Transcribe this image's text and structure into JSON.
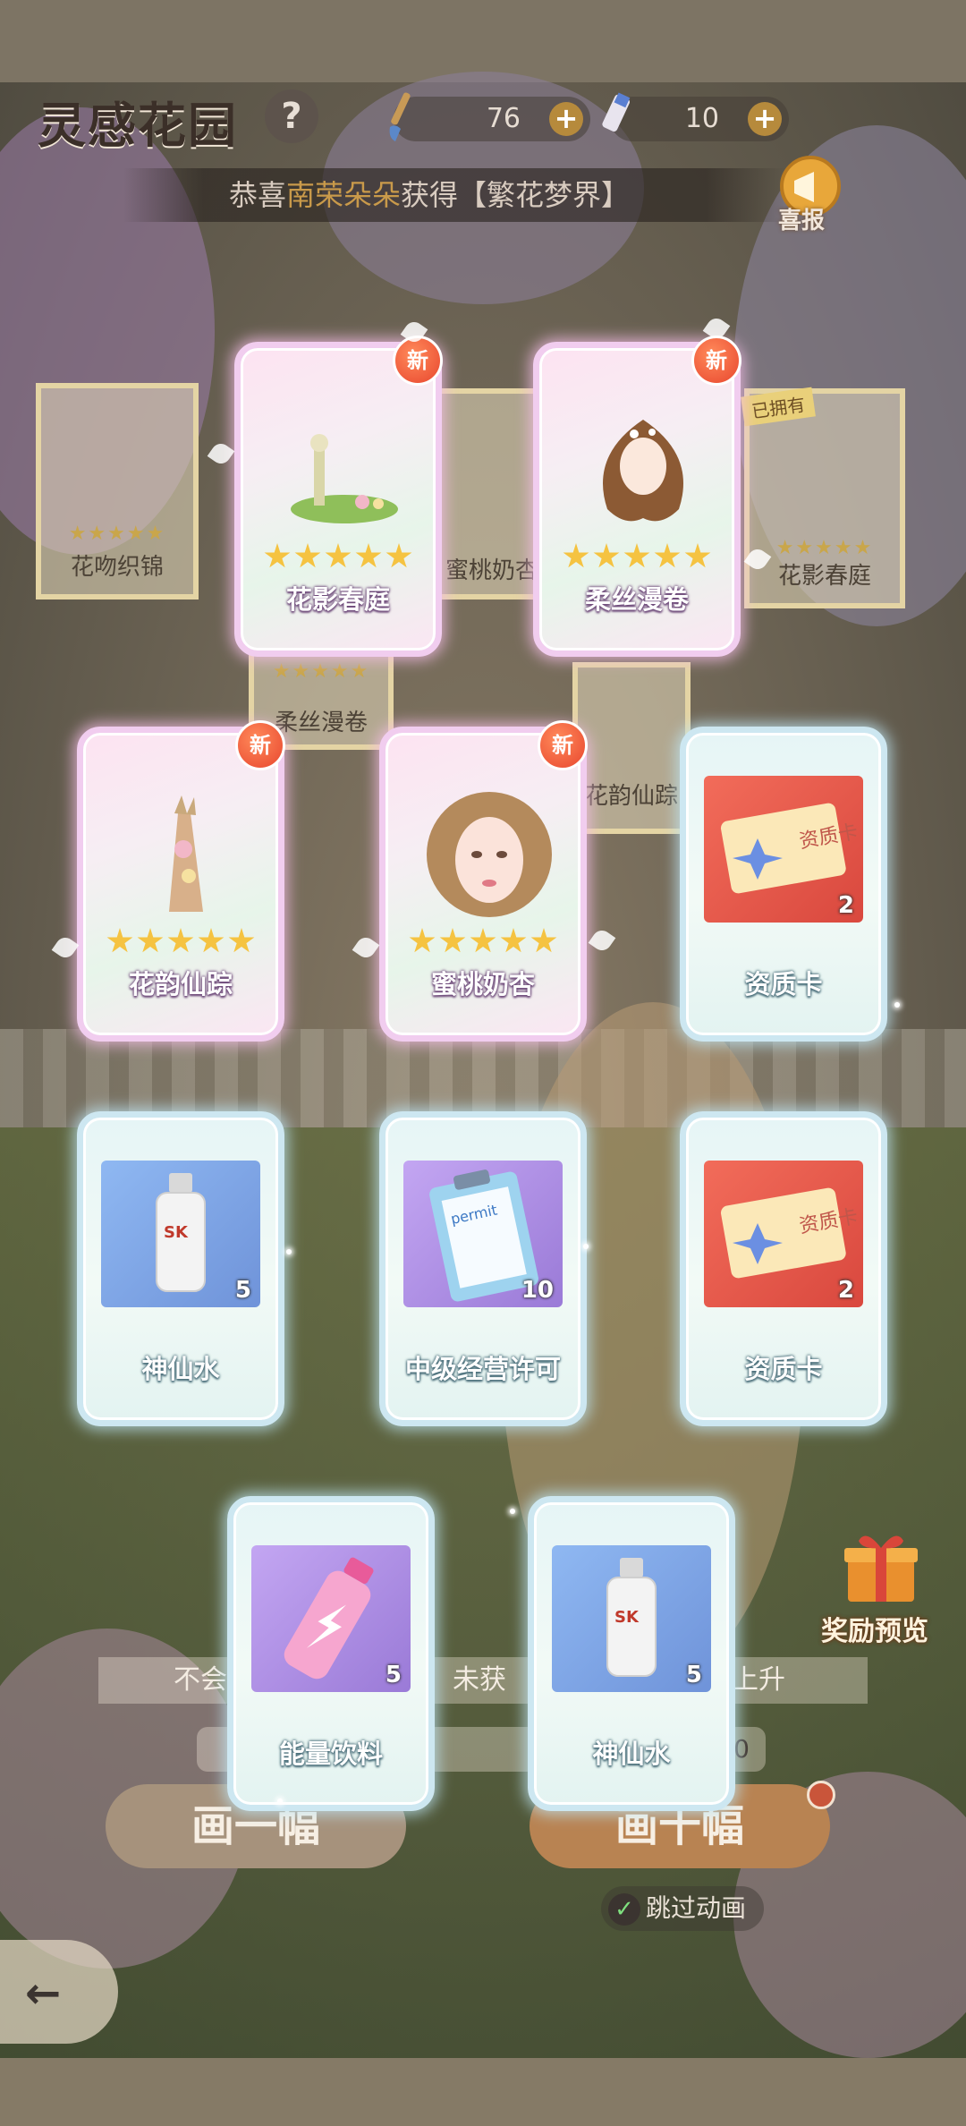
{
  "header": {
    "title": "灵感花园",
    "help_icon": "question-icon",
    "currency1": {
      "icon": "brush-icon",
      "value": "76"
    },
    "currency2": {
      "icon": "paint-tube-icon",
      "value": "10"
    }
  },
  "broadcast": {
    "prefix": "恭喜",
    "player": "南荣朵朵",
    "verb": "获得",
    "reward": "【繁花梦界】",
    "horn_label": "喜报"
  },
  "background_cards": [
    {
      "name": "花吻织锦"
    },
    {
      "name": "蜜桃奶杏"
    },
    {
      "name": "花影春庭",
      "tag": "已拥有"
    },
    {
      "name": "柔丝漫卷"
    },
    {
      "name": "花韵仙踪"
    }
  ],
  "rewards": [
    {
      "name": "花影春庭",
      "type": "outfit",
      "stars": 5,
      "new_badge": "新"
    },
    {
      "name": "柔丝漫卷",
      "type": "outfit",
      "stars": 5,
      "new_badge": "新"
    },
    {
      "name": "花韵仙踪",
      "type": "outfit",
      "stars": 5,
      "new_badge": "新"
    },
    {
      "name": "蜜桃奶杏",
      "type": "outfit",
      "stars": 5,
      "new_badge": "新"
    },
    {
      "name": "资质卡",
      "type": "item",
      "icon": "ticket-card-icon",
      "qty": "2"
    },
    {
      "name": "神仙水",
      "type": "item",
      "icon": "essence-bottle-icon",
      "qty": "5"
    },
    {
      "name": "中级经营许可",
      "type": "item",
      "icon": "permit-clipboard-icon",
      "qty": "10"
    },
    {
      "name": "资质卡",
      "type": "item",
      "icon": "ticket-card-icon",
      "qty": "2"
    },
    {
      "name": "能量饮料",
      "type": "item",
      "icon": "energy-drink-icon",
      "qty": "5"
    },
    {
      "name": "神仙水",
      "type": "item",
      "icon": "essence-bottle-icon",
      "qty": "5"
    }
  ],
  "bottom": {
    "info_left": "不会",
    "info_mid": "未获",
    "info_right": "上升",
    "counter_tail": "0",
    "btn_one": "画一幅",
    "btn_ten": "画十幅",
    "skip_label": "跳过动画",
    "gift_label": "奖励预览",
    "back_icon": "back-arrow-icon"
  },
  "colors": {
    "pink_frame": "#f1cdef",
    "blue_frame": "#cde7f1",
    "star": "#f5c341",
    "new_badge": "#e8462e",
    "highlight_name": "#c99a4a"
  }
}
